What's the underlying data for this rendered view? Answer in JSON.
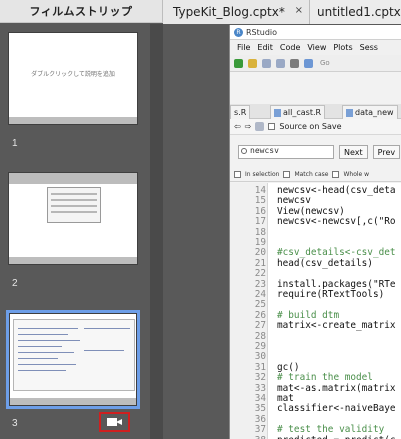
{
  "filmstrip": {
    "header": "フィルムストリップ",
    "slides": [
      {
        "number": "1",
        "hint": "ダブルクリックして説明を追加"
      },
      {
        "number": "2"
      },
      {
        "number": "3",
        "selected": true,
        "has_video": true
      }
    ],
    "accent": "#6d9ee8",
    "video_icon_outline": "#d01f1f"
  },
  "tabs": [
    {
      "label": "TypeKit_Blog.cptx*",
      "close": "×"
    },
    {
      "label": "untitled1.cptx*"
    }
  ],
  "rstudio": {
    "title": "RStudio",
    "menu": [
      "File",
      "Edit",
      "Code",
      "View",
      "Plots",
      "Sess"
    ],
    "go_to_file": "Go",
    "file_tabs": [
      "s.R",
      "all_cast.R",
      "data_new"
    ],
    "source_on_save": "Source on Save",
    "find": {
      "value": "newcsv",
      "next": "Next",
      "prev": "Prev"
    },
    "options": [
      "In selection",
      "Match case",
      "Whole w"
    ],
    "code_lines": [
      {
        "n": "14",
        "text": "newcsv<-head(csv_deta"
      },
      {
        "n": "15",
        "text": "newcsv"
      },
      {
        "n": "16",
        "text": "View(newcsv)"
      },
      {
        "n": "17",
        "text": "newcsv<-newcsv[,c(\"Ro"
      },
      {
        "n": "18",
        "text": ""
      },
      {
        "n": "19",
        "text": ""
      },
      {
        "n": "20",
        "text": "#csv_details<-csv_det",
        "comment": true
      },
      {
        "n": "21",
        "text": "head(csv_details)"
      },
      {
        "n": "22",
        "text": ""
      },
      {
        "n": "23",
        "text": "install.packages(\"RTe"
      },
      {
        "n": "24",
        "text": "require(RTextTools)"
      },
      {
        "n": "25",
        "text": ""
      },
      {
        "n": "26",
        "text": "# build dtm",
        "comment": true
      },
      {
        "n": "27",
        "text": "matrix<-create_matrix"
      },
      {
        "n": "28",
        "text": ""
      },
      {
        "n": "29",
        "text": ""
      },
      {
        "n": "30",
        "text": ""
      },
      {
        "n": "31",
        "text": "gc()"
      },
      {
        "n": "32",
        "text": "# train the model",
        "comment": true
      },
      {
        "n": "33",
        "text": "mat<-as.matrix(matrix"
      },
      {
        "n": "34",
        "text": "mat"
      },
      {
        "n": "35",
        "text": "classifier<-naiveBaye"
      },
      {
        "n": "36",
        "text": ""
      },
      {
        "n": "37",
        "text": "# test the validity",
        "comment": true
      },
      {
        "n": "38",
        "text": "predicted = predict(c"
      }
    ]
  }
}
